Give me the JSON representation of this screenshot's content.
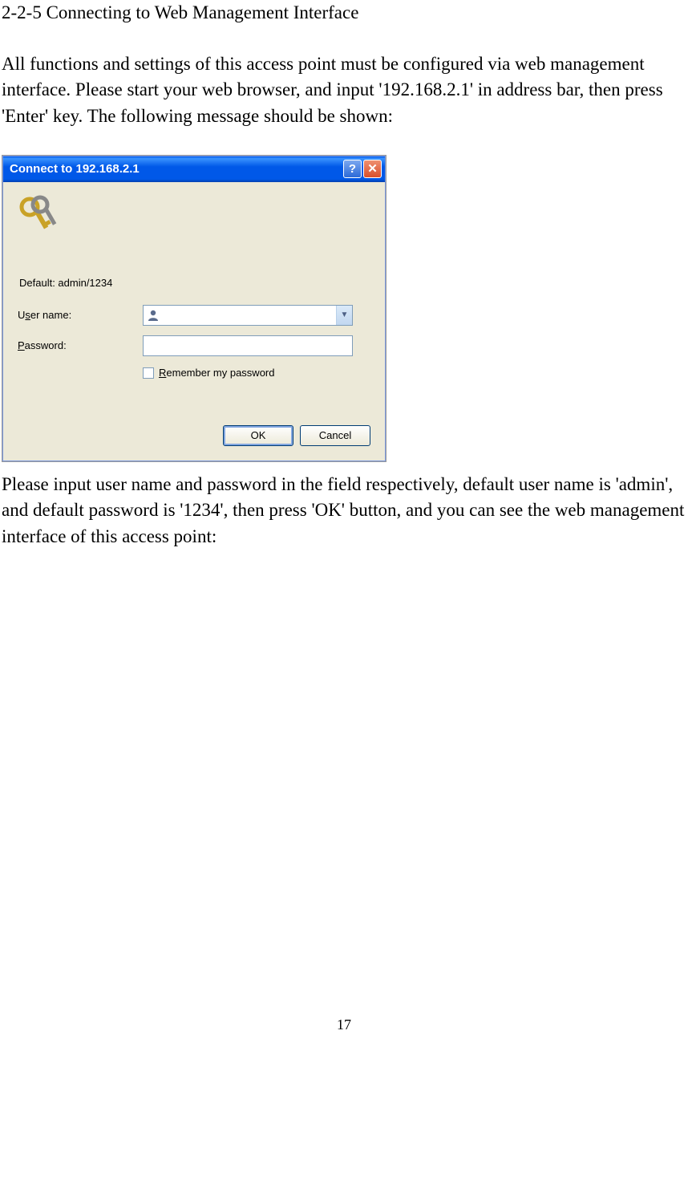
{
  "section_title": "2-2-5 Connecting to Web Management Interface",
  "intro_paragraph": "All functions and settings of this access point must be configured via web management interface. Please start your web browser, and input '192.168.2.1' in address bar, then press 'Enter' key. The following message should be shown:",
  "dialog": {
    "title": "Connect to 192.168.2.1",
    "default_text": "Default: admin/1234",
    "username_label_prefix": "U",
    "username_label_underlined": "s",
    "username_label_suffix": "er name:",
    "password_label_underlined": "P",
    "password_label_suffix": "assword:",
    "remember_label_underlined": "R",
    "remember_label_suffix": "emember my password",
    "ok_label": "OK",
    "cancel_label": "Cancel"
  },
  "closing_paragraph": "Please input user name and password in the field respectively, default user name is 'admin', and default password is '1234', then press 'OK' button, and you can see the web management interface of this access point:",
  "page_number": "17"
}
